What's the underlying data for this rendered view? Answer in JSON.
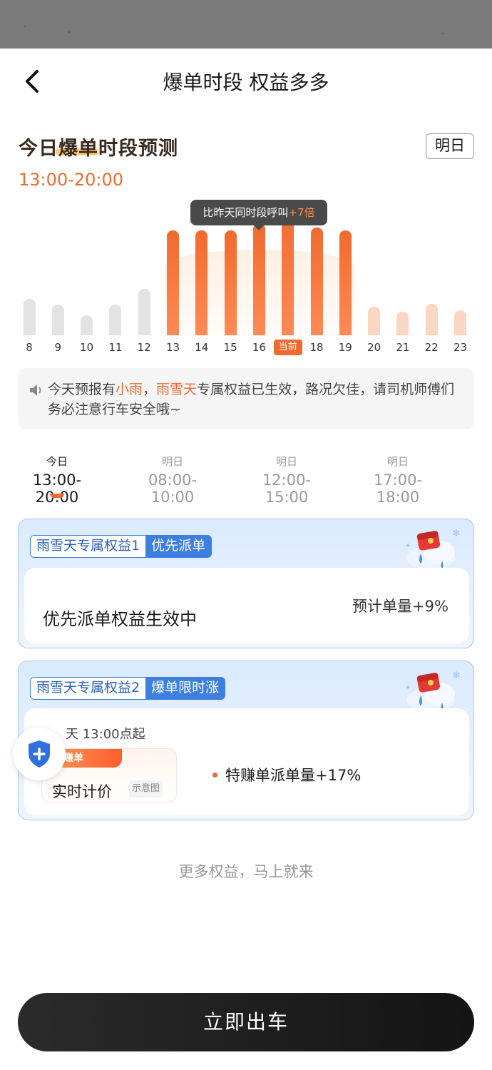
{
  "nav": {
    "title": "爆单时段 权益多多"
  },
  "forecast": {
    "title": "今日爆单时段预测",
    "tomorrow_label": "明日",
    "time_range": "13:00-20:00"
  },
  "chart_data": {
    "type": "bar",
    "categories": [
      "8",
      "9",
      "10",
      "11",
      "12",
      "13",
      "14",
      "15",
      "16",
      "当前",
      "18",
      "19",
      "20",
      "21",
      "22",
      "23"
    ],
    "values": [
      38,
      32,
      21,
      32,
      49,
      110,
      110,
      110,
      118,
      137,
      113,
      110,
      30,
      25,
      33,
      26
    ],
    "ylim": [
      0,
      150
    ],
    "current_category": "当前",
    "tooltip_prefix": "比昨天同时段呼叫",
    "tooltip_value": "+7倍",
    "colors": {
      "peak": "#f06a2d",
      "offpeak_past": "#e3e3e3",
      "offpeak_future": "#fbd6c2"
    }
  },
  "notice": {
    "p1": "今天预报有",
    "w1": "小雨",
    "p2": "，",
    "w2": "雨雪天",
    "p3": "专属权益已生效，路况欠佳，请司机师傅们务必注意行车安全哦~"
  },
  "slots": [
    {
      "day": "今日",
      "range": "13:00-20:00",
      "active": true
    },
    {
      "day": "明日",
      "range": "08:00-10:00",
      "active": false
    },
    {
      "day": "明日",
      "range": "12:00-15:00",
      "active": false
    },
    {
      "day": "明日",
      "range": "17:00-18:00",
      "active": false
    }
  ],
  "card1": {
    "tag_left": "雨雪天专属权益1",
    "tag_right": "优先派单",
    "status": "优先派单权益生效中",
    "estimate": "预计单量+9%"
  },
  "card2": {
    "tag_left": "雨雪天专属权益2",
    "tag_right": "爆单限时涨",
    "start": "天 13:00点起",
    "badge": "赚单",
    "price_label": "实时计价",
    "sample": "示意图",
    "bullet": "特赚单派单量+17%"
  },
  "more_text": "更多权益，马上就来",
  "go_button": "立即出车",
  "colors": {
    "accent": "#f06a2d",
    "blue": "#3d7fe0",
    "button_dark": "#1a1a1a"
  }
}
